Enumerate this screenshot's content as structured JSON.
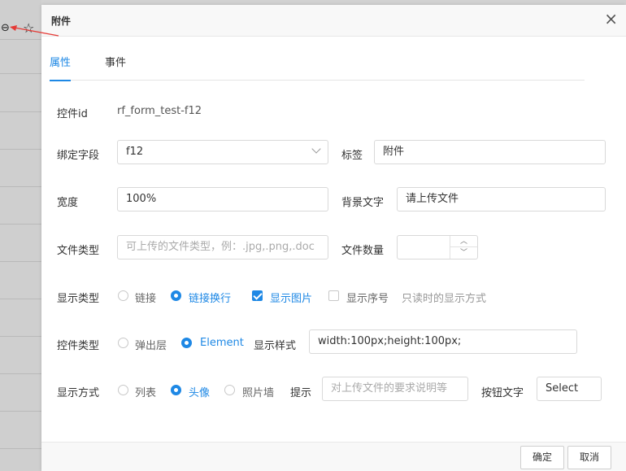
{
  "background": {
    "link_icon": "link-icon",
    "star_icon": "star-icon"
  },
  "dialog": {
    "title": "附件",
    "close_symbol": "×",
    "tabs": [
      {
        "label": "属性",
        "active": true
      },
      {
        "label": "事件",
        "active": false
      }
    ],
    "fields": {
      "control_id_label": "控件id",
      "control_id_value": "rf_form_test-f12",
      "bind_field_label": "绑定字段",
      "bind_field_value": "f12",
      "tag_label": "标签",
      "tag_value": "附件",
      "width_label": "宽度",
      "width_value": "100%",
      "bg_text_label": "背景文字",
      "bg_text_value": "请上传文件",
      "file_type_label": "文件类型",
      "file_type_placeholder": "可上传的文件类型，例：.jpg,.png,.doc",
      "file_count_label": "文件数量",
      "file_count_value": "",
      "display_type_label": "显示类型",
      "display_type_options": [
        "链接",
        "链接换行"
      ],
      "display_type_selected": "链接换行",
      "show_image_label": "显示图片",
      "show_image_checked": true,
      "show_index_label": "显示序号",
      "show_index_checked": false,
      "readonly_hint": "只读时的显示方式",
      "control_type_label": "控件类型",
      "control_type_options": [
        "弹出层",
        "Element"
      ],
      "control_type_selected": "Element",
      "display_style_label": "显示样式",
      "display_style_value": "width:100px;height:100px;",
      "display_mode_label": "显示方式",
      "display_mode_options": [
        "列表",
        "头像",
        "照片墙"
      ],
      "display_mode_selected": "头像",
      "tip_label": "提示",
      "tip_placeholder": "对上传文件的要求说明等",
      "button_text_label": "按钮文字",
      "button_text_value": "Select"
    },
    "footer": {
      "ok_label": "确定",
      "cancel_label": "取消"
    }
  },
  "colors": {
    "accent": "#1e88e5",
    "arrow": "#e53935"
  }
}
